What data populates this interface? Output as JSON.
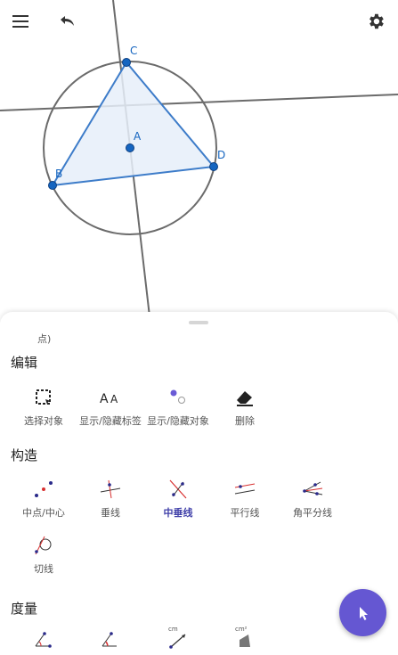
{
  "toolbar": {
    "menu_icon": "menu-icon",
    "undo_icon": "undo-icon",
    "settings_icon": "gear-icon"
  },
  "canvas": {
    "points": [
      {
        "label": "A"
      },
      {
        "label": "B"
      },
      {
        "label": "C"
      },
      {
        "label": "D"
      }
    ],
    "colors": {
      "point": "#1565c0",
      "triangle_stroke": "#3d7cc9",
      "triangle_fill": "#e6eef9",
      "lines": "#6b6b6b"
    }
  },
  "panel": {
    "partial_label": "点)",
    "sections": [
      {
        "title": "编辑",
        "tools": [
          {
            "label": "选择对象",
            "icon": "select-box-icon"
          },
          {
            "label": "显示/隐藏标签",
            "icon": "label-aa-icon"
          },
          {
            "label": "显示/隐藏对象",
            "icon": "show-hide-icon"
          },
          {
            "label": "删除",
            "icon": "eraser-icon"
          }
        ]
      },
      {
        "title": "构造",
        "tools": [
          {
            "label": "中点/中心",
            "icon": "midpoint-icon"
          },
          {
            "label": "垂线",
            "icon": "perpendicular-line-icon"
          },
          {
            "label": "中垂线",
            "icon": "perpendicular-bisector-icon",
            "active": true
          },
          {
            "label": "平行线",
            "icon": "parallel-line-icon"
          },
          {
            "label": "角平分线",
            "icon": "angle-bisector-icon"
          },
          {
            "label": "切线",
            "icon": "tangent-icon"
          }
        ]
      },
      {
        "title": "度量",
        "tools": [
          {
            "label": "",
            "icon": "angle-icon"
          },
          {
            "label": "",
            "icon": "angle-given-size-icon"
          },
          {
            "label": "cm",
            "icon": "distance-icon"
          },
          {
            "label": "cm²",
            "icon": "area-icon"
          }
        ]
      }
    ],
    "active_color": "#3f3fa8"
  },
  "fab": {
    "icon": "cursor-arrow-icon",
    "color": "#6557d2"
  }
}
